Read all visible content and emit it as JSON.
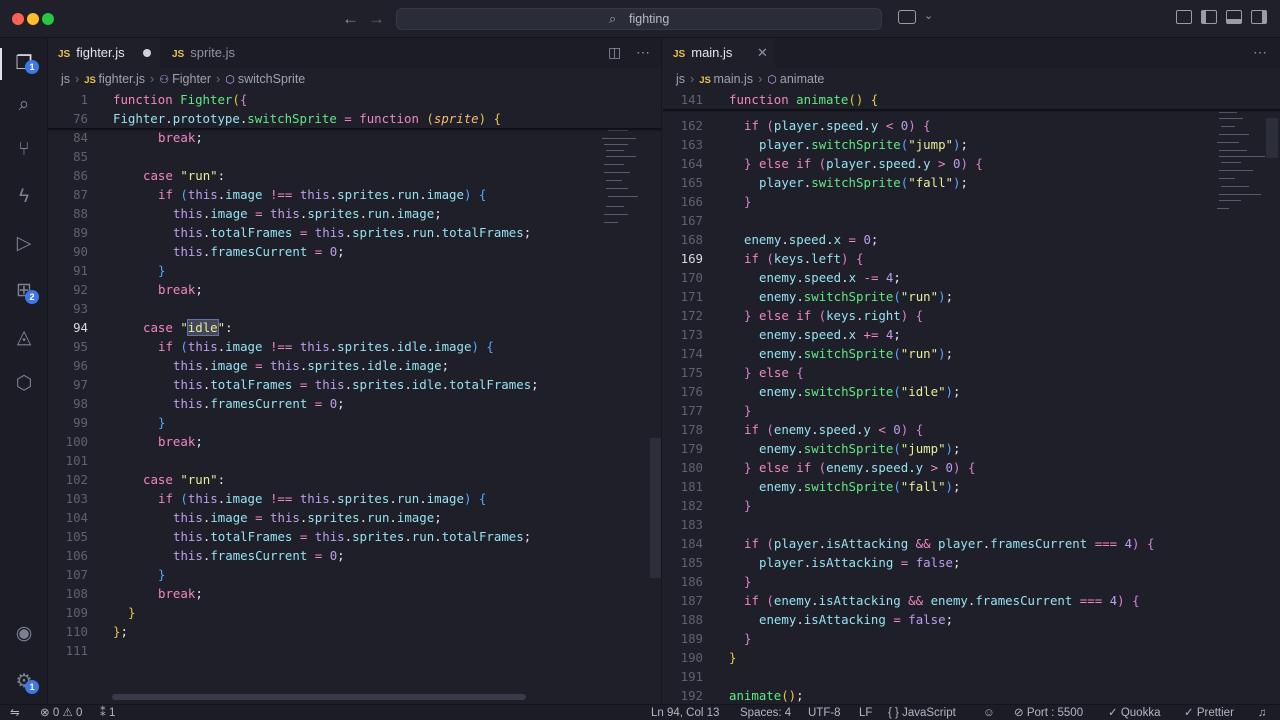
{
  "search": {
    "text": "fighting"
  },
  "activity": {
    "explorer_badge": "1",
    "extensions_badge": "2",
    "manage_badge": "1"
  },
  "left": {
    "tabs": [
      {
        "label": "fighter.js",
        "modified": true,
        "active": true
      },
      {
        "label": "sprite.js",
        "active": false
      }
    ],
    "breadcrumb": {
      "folder": "js",
      "file": "fighter.js",
      "symbol1": "Fighter",
      "symbol2": "switchSprite"
    }
  },
  "right": {
    "tabs": [
      {
        "label": "main.js",
        "active": true
      }
    ],
    "breadcrumb": {
      "folder": "js",
      "file": "main.js",
      "symbol1": "animate"
    }
  },
  "status": {
    "errors": "0",
    "warnings": "0",
    "ports": "1",
    "cursor": "Ln 94, Col 13",
    "spaces": "Spaces: 4",
    "encoding": "UTF-8",
    "eol": "LF",
    "language": "JavaScript",
    "port": "Port : 5500",
    "quokka": "Quokka",
    "prettier": "Prettier"
  },
  "colors": {
    "keyword": "#f286c4",
    "function": "#62e884",
    "string": "#e7ee98",
    "number": "#bf9eee",
    "property": "#97e1f1",
    "accent": "#3f77e6"
  }
}
